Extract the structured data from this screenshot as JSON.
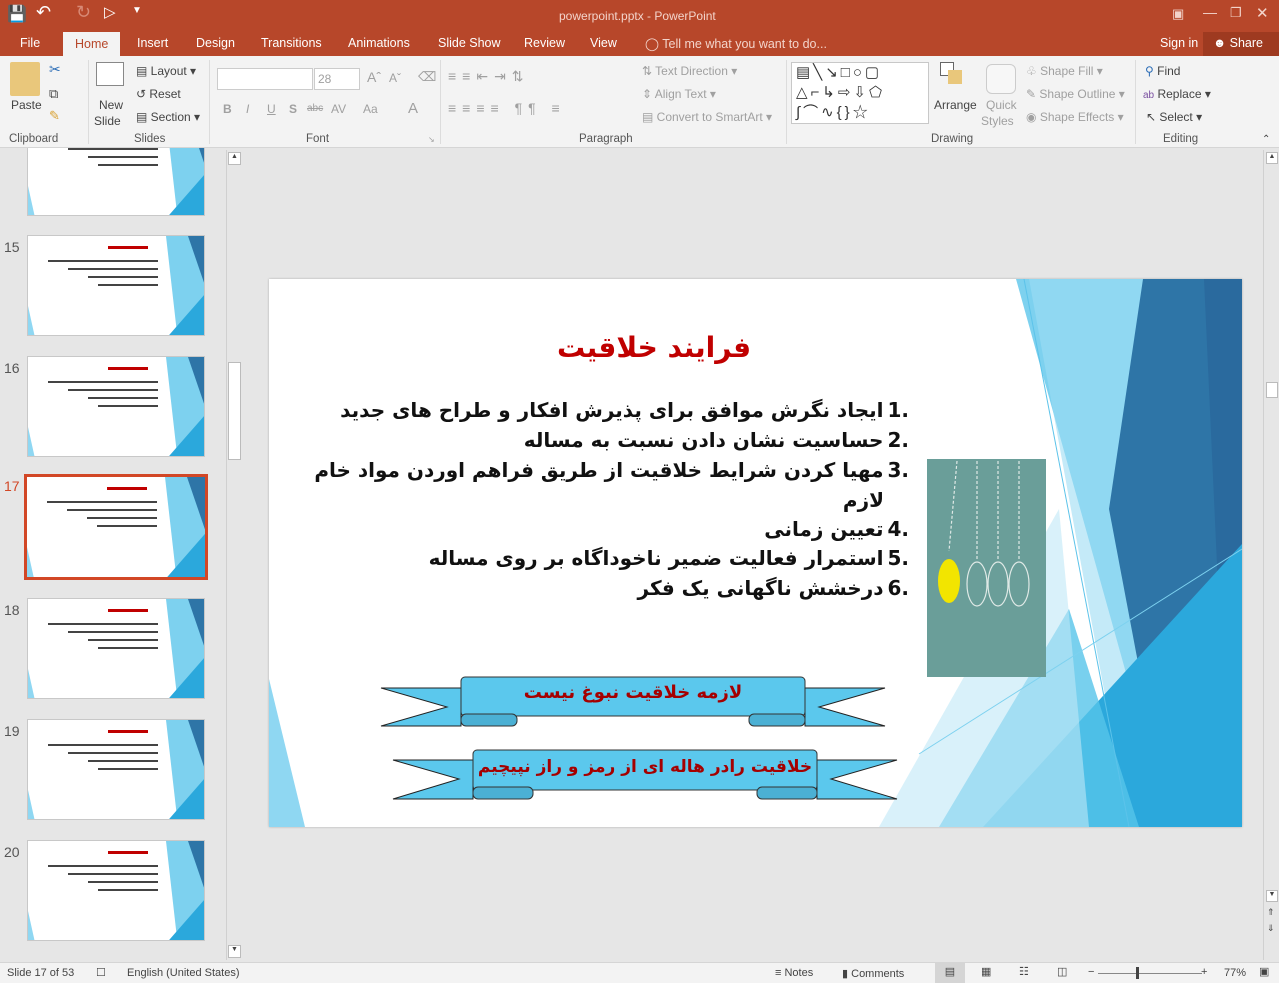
{
  "window": {
    "title": "powerpoint.pptx - PowerPoint"
  },
  "qat": {
    "icons": [
      "save-icon",
      "undo-icon",
      "redo-icon",
      "start-from-beginning-icon",
      "customize-icon"
    ]
  },
  "tabs": [
    {
      "label": "File"
    },
    {
      "label": "Home",
      "active": true
    },
    {
      "label": "Insert"
    },
    {
      "label": "Design"
    },
    {
      "label": "Transitions"
    },
    {
      "label": "Animations"
    },
    {
      "label": "Slide Show"
    },
    {
      "label": "Review"
    },
    {
      "label": "View"
    }
  ],
  "tellme": "Tell me what you want to do...",
  "signin": "Sign in",
  "share": "Share",
  "ribbon": {
    "clipboard": {
      "paste": "Paste",
      "group": "Clipboard"
    },
    "slides": {
      "new_slide_1": "New",
      "new_slide_2": "Slide",
      "layout": "Layout",
      "reset": "Reset",
      "section": "Section",
      "group": "Slides"
    },
    "font": {
      "font_name": "",
      "font_size": "28",
      "group": "Font",
      "bold": "B",
      "italic": "I",
      "underline": "U",
      "shadow": "S",
      "strike": "abc",
      "spacing": "AV",
      "case": "Aa",
      "color": "A"
    },
    "paragraph": {
      "text_direction": "Text Direction",
      "align_text": "Align Text",
      "convert_smartart": "Convert to SmartArt",
      "group": "Paragraph"
    },
    "drawing": {
      "arrange": "Arrange",
      "quick_1": "Quick",
      "quick_2": "Styles",
      "shape_fill": "Shape Fill",
      "shape_outline": "Shape Outline",
      "shape_effects": "Shape Effects",
      "group": "Drawing"
    },
    "editing": {
      "find": "Find",
      "replace": "Replace",
      "select": "Select",
      "group": "Editing"
    }
  },
  "thumbnails": [
    {
      "num": "15"
    },
    {
      "num": "16"
    },
    {
      "num": "17",
      "selected": true
    },
    {
      "num": "18"
    },
    {
      "num": "19"
    },
    {
      "num": "20"
    }
  ],
  "slide": {
    "title": "فرایند خلاقیت",
    "items": [
      {
        "n": "1.",
        "text": "ایجاد نگرش موافق برای پذیرش افکار و طراح های جدید"
      },
      {
        "n": "2.",
        "text": "حساسیت نشان دادن نسبت به مساله"
      },
      {
        "n": "3.",
        "text": "مهیا کردن شرایط خلاقیت از طریق فراهم اوردن مواد خام"
      },
      {
        "n": "",
        "text": "لازم"
      },
      {
        "n": "4.",
        "text": "تعیین زمانی"
      },
      {
        "n": "5.",
        "text": "استمرار فعالیت ضمیر ناخوداگاه بر روی مساله"
      },
      {
        "n": "6.",
        "text": "درخشش ناگهانی یک فکر"
      }
    ],
    "banner1": "لازمه خلاقیت نبوغ نیست",
    "banner2": "خلاقیت رادر هاله ای از رمز و راز نپیچیم",
    "colors": {
      "title": "#c00000",
      "banner_fill": "#5bc8ed",
      "banner_text": "#a50000",
      "picture": "#6a9e99"
    }
  },
  "status": {
    "slide": "Slide 17 of 53",
    "language": "English (United States)",
    "notes": "Notes",
    "comments": "Comments",
    "zoom": "77%",
    "zoom_level": 77
  },
  "colors": {
    "accent": "#b7472a"
  }
}
